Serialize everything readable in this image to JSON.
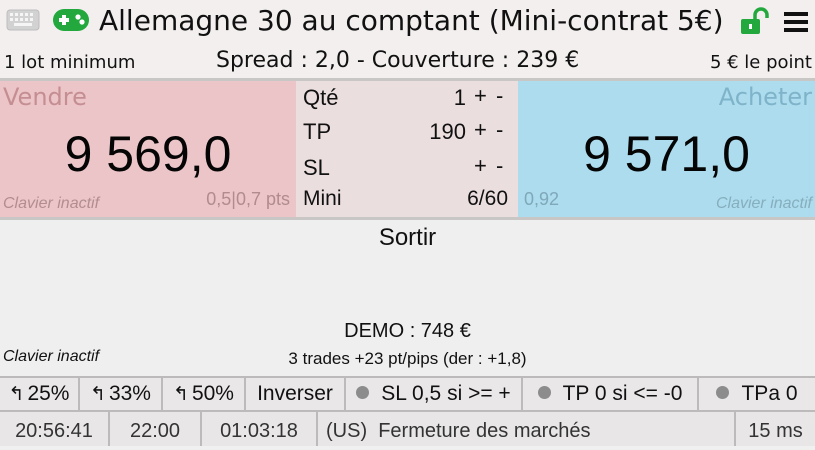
{
  "title": "Allemagne 30 au comptant (Mini-contrat 5€)",
  "icons": {
    "keyboard": "keyboard-icon",
    "gamepad": "gamepad-icon",
    "lock": "unlocked-padlock-icon",
    "menu": "hamburger-menu-icon"
  },
  "colors": {
    "gamepad": "#22a83c",
    "lock": "#22a83c",
    "sell_bg": "#ecc5c8",
    "buy_bg": "#acdced",
    "mid_bg": "#ebdedf"
  },
  "info": {
    "min_lot": "1 lot minimum",
    "spread_cover": "Spread : 2,0 - Couverture : 239 €",
    "per_point": "5 € le point"
  },
  "sell": {
    "label": "Vendre",
    "price": "9 569,0",
    "keyboard_status": "Clavier inactif",
    "spread_pts": "0,5|0,7 pts"
  },
  "order": {
    "qty_label": "Qté",
    "qty_value": "1",
    "tp_label": "TP",
    "tp_value": "190",
    "sl_label": "SL",
    "sl_value": "",
    "mini_label": "Mini",
    "mini_value": "6/60",
    "plus": "+",
    "minus": "-"
  },
  "buy": {
    "label": "Acheter",
    "price": "9 571,0",
    "keyboard_status": "Clavier inactif",
    "spread_value": "0,92"
  },
  "exit": {
    "label": "Sortir",
    "demo": "DEMO : 748 €",
    "trades": "3 trades +23 pt/pips (der : +1,8)",
    "keyboard_status": "Clavier inactif"
  },
  "actions": {
    "pct25": "25%",
    "pct33": "33%",
    "pct50": "50%",
    "invert": "Inverser",
    "sl_rule": "SL 0,5 si >= +",
    "tp_rule": "TP 0 si <= -0",
    "tpa": "TPa 0"
  },
  "status": {
    "time": "20:56:41",
    "close_time": "22:00",
    "countdown": "01:03:18",
    "market_msg": "(US)  Fermeture des marchés",
    "latency": "15 ms"
  }
}
